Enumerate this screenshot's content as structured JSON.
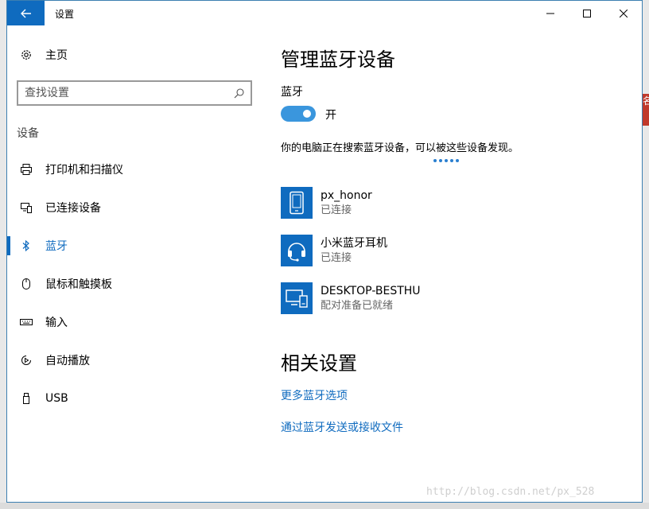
{
  "window": {
    "title": "设置"
  },
  "background": {
    "red_tag_text": "名"
  },
  "nav": {
    "home_label": "主页",
    "search_placeholder": "查找设置",
    "section_label": "设备",
    "items": [
      {
        "label": "打印机和扫描仪",
        "icon": "printer-icon",
        "active": false
      },
      {
        "label": "已连接设备",
        "icon": "connected-devices-icon",
        "active": false
      },
      {
        "label": "蓝牙",
        "icon": "bluetooth-icon",
        "active": true
      },
      {
        "label": "鼠标和触摸板",
        "icon": "mouse-icon",
        "active": false
      },
      {
        "label": "输入",
        "icon": "keyboard-icon",
        "active": false
      },
      {
        "label": "自动播放",
        "icon": "autoplay-icon",
        "active": false
      },
      {
        "label": "USB",
        "icon": "usb-icon",
        "active": false
      }
    ]
  },
  "main": {
    "title": "管理蓝牙设备",
    "bluetooth_label": "蓝牙",
    "toggle_state": "开",
    "description": "你的电脑正在搜索蓝牙设备，可以被这些设备发现。",
    "devices": [
      {
        "name": "px_honor",
        "status": "已连接",
        "icon": "phone-icon"
      },
      {
        "name": "小米蓝牙耳机",
        "status": "已连接",
        "icon": "headset-icon"
      },
      {
        "name": "DESKTOP-BESTHU",
        "status": "配对准备已就绪",
        "icon": "computer-icon"
      }
    ],
    "related_title": "相关设置",
    "links": [
      "更多蓝牙选项",
      "通过蓝牙发送或接收文件"
    ]
  },
  "watermark": "http://blog.csdn.net/px_528",
  "colors": {
    "accent": "#0f6bbf",
    "toggle_on": "#3a96dd"
  }
}
